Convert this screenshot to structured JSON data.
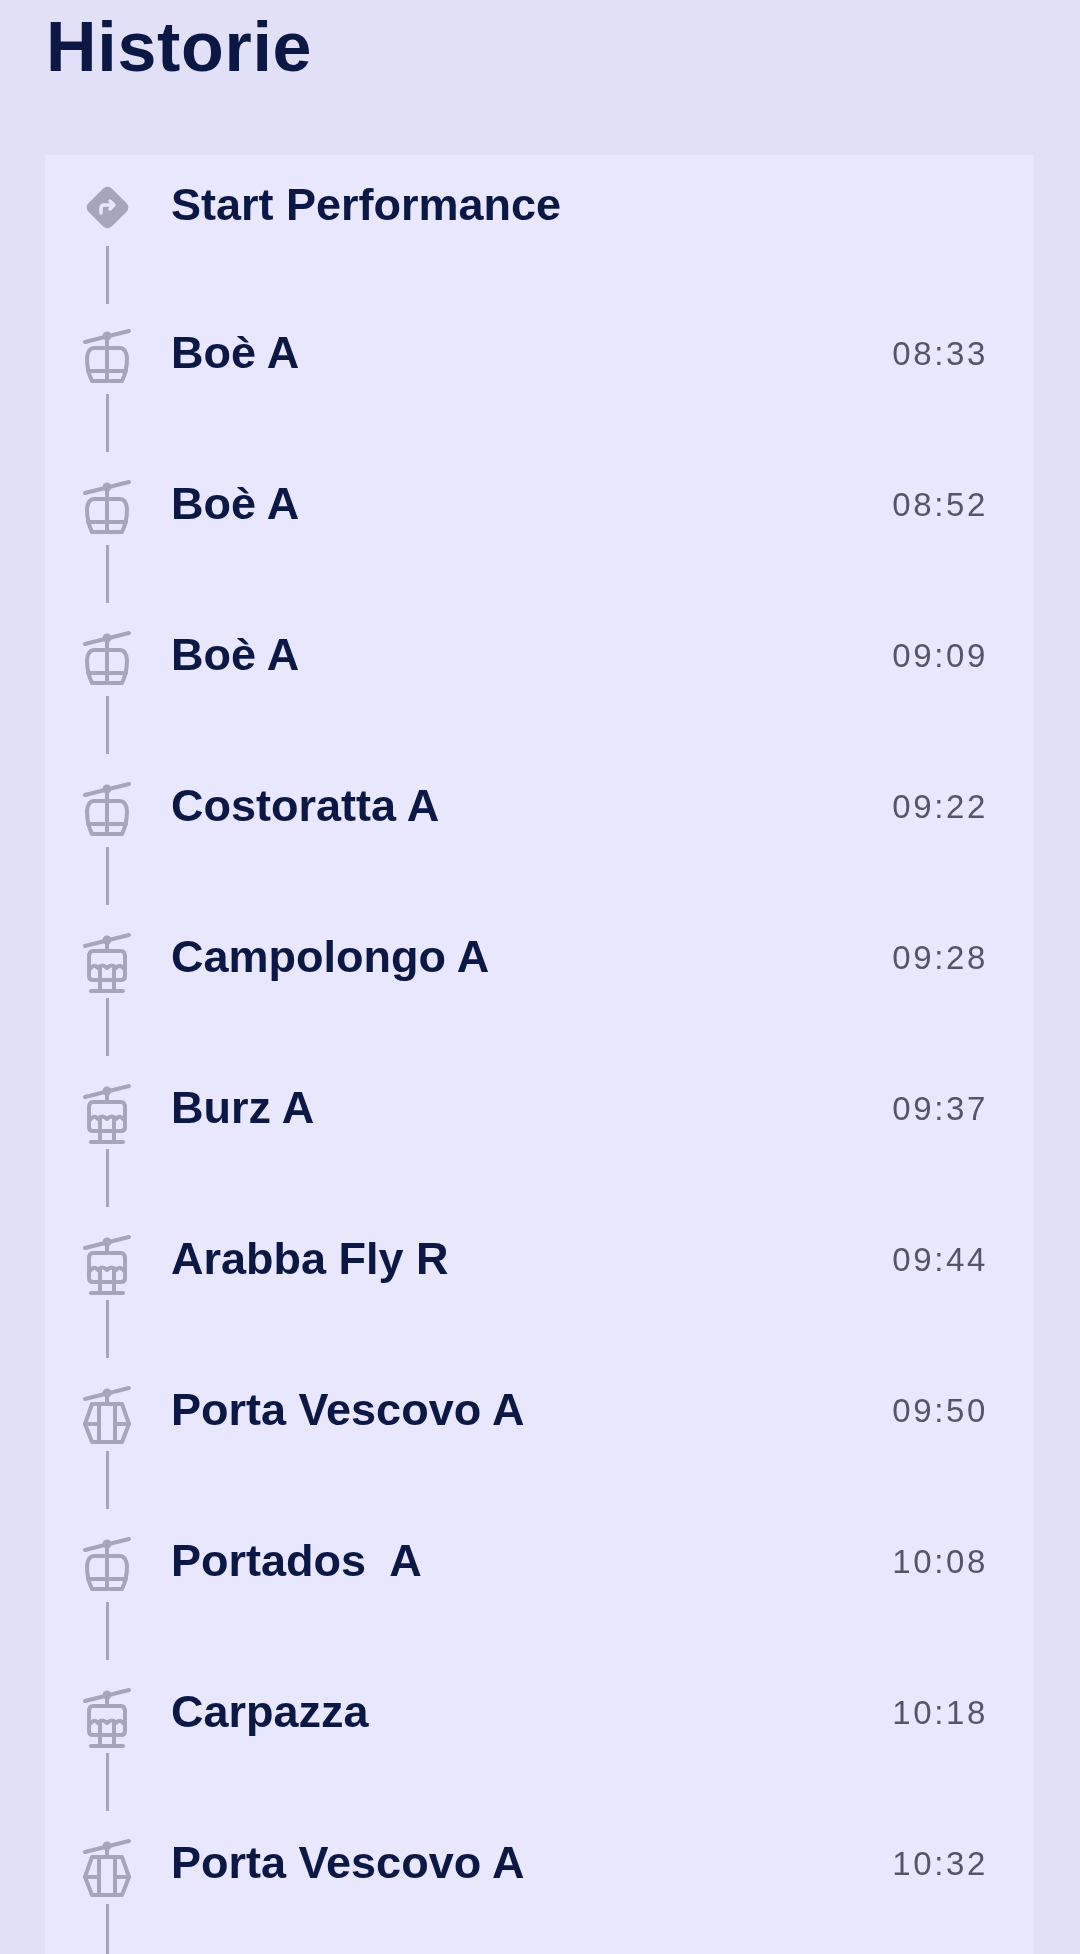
{
  "title": "Historie",
  "history": [
    {
      "kind": "start",
      "name": "Start Performance"
    },
    {
      "kind": "gondola",
      "name": "Boè A",
      "time": "08:33"
    },
    {
      "kind": "gondola",
      "name": "Boè A",
      "time": "08:52"
    },
    {
      "kind": "gondola",
      "name": "Boè A",
      "time": "09:09"
    },
    {
      "kind": "gondola",
      "name": "Costoratta A",
      "time": "09:22"
    },
    {
      "kind": "cabin",
      "name": "Campolongo A",
      "time": "09:28"
    },
    {
      "kind": "cabin",
      "name": "Burz A",
      "time": "09:37"
    },
    {
      "kind": "cabin",
      "name": "Arabba Fly R",
      "time": "09:44"
    },
    {
      "kind": "cable_car",
      "name": "Porta Vescovo A",
      "time": "09:50"
    },
    {
      "kind": "gondola",
      "name": "Portados  A",
      "time": "10:08"
    },
    {
      "kind": "cabin",
      "name": "Carpazza",
      "time": "10:18"
    },
    {
      "kind": "cable_car",
      "name": "Porta Vescovo A",
      "time": "10:32"
    }
  ]
}
